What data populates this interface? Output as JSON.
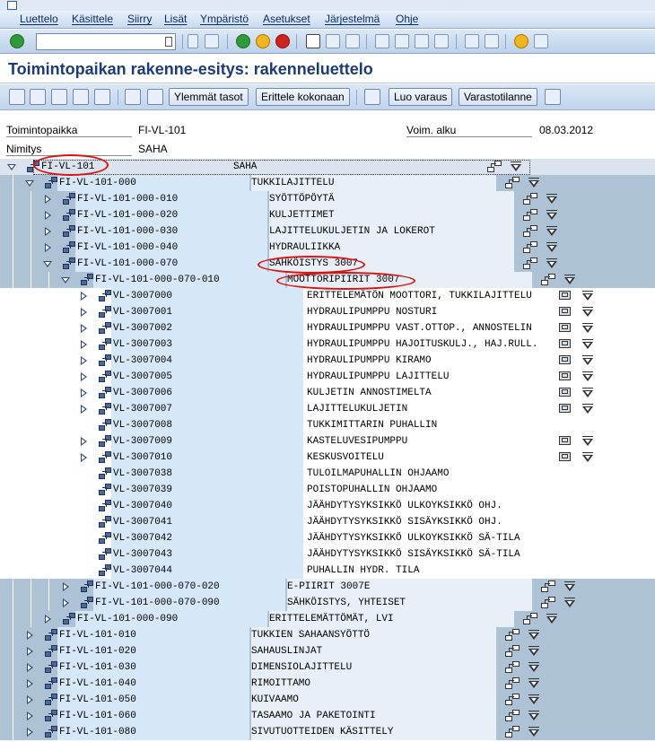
{
  "menu": [
    "Luettelo",
    "Käsittele",
    "Siirry",
    "Lisät",
    "Ympäristö",
    "Asetukset",
    "Järjestelmä",
    "Ohje"
  ],
  "command_field": {
    "value": ""
  },
  "title": "Toimintopaikan rakenne-esitys: rakenneluettelo",
  "app_buttons": [
    "Ylemmät tasot",
    "Erittele kokonaan",
    "Luo varaus",
    "Varastotilanne"
  ],
  "header": {
    "func_loc_label": "Toimintopaikka",
    "func_loc_value": "FI-VL-101",
    "valid_from_label": "Voim. alku",
    "valid_from_value": "08.03.2012",
    "desc_label": "Nimitys",
    "desc_value": "SAHA"
  },
  "rows": [
    {
      "level": 0,
      "state": "open",
      "id": "FI-VL-101",
      "desc": "SAHA",
      "icon": "funcloc",
      "act": true
    },
    {
      "level": 1,
      "state": "open",
      "id": "FI-VL-101-000",
      "desc": "TUKKILAJITTELU",
      "icon": "funcloc",
      "act": true
    },
    {
      "level": 2,
      "state": "closed",
      "id": "FI-VL-101-000-010",
      "desc": "SYÖTTÖPÖYTÄ",
      "icon": "funcloc",
      "act": true
    },
    {
      "level": 2,
      "state": "closed",
      "id": "FI-VL-101-000-020",
      "desc": "KULJETTIMET",
      "icon": "funcloc",
      "act": true
    },
    {
      "level": 2,
      "state": "closed",
      "id": "FI-VL-101-000-030",
      "desc": "LAJITTELUKULJETIN JA LOKEROT",
      "icon": "funcloc",
      "act": true
    },
    {
      "level": 2,
      "state": "closed",
      "id": "FI-VL-101-000-040",
      "desc": "HYDRAULIIKKA",
      "icon": "funcloc",
      "act": true
    },
    {
      "level": 2,
      "state": "open",
      "id": "FI-VL-101-000-070",
      "desc": "SÄHKÖISTYS 3007",
      "icon": "funcloc",
      "act": true
    },
    {
      "level": 3,
      "state": "open",
      "id": "FI-VL-101-000-070-010",
      "desc": "MOOTTORIPIIRIT 3007",
      "icon": "funcloc",
      "act": true
    },
    {
      "level": 4,
      "state": "closed",
      "id": "VL-3007000",
      "desc": "ERITTELEMÄTÖN MOOTTORI, TUKKILAJITTELU",
      "icon": "equip",
      "act": true
    },
    {
      "level": 4,
      "state": "closed",
      "id": "VL-3007001",
      "desc": "HYDRAULIPUMPPU NOSTURI",
      "icon": "equip",
      "act": true
    },
    {
      "level": 4,
      "state": "closed",
      "id": "VL-3007002",
      "desc": "HYDRAULIPUMPPU VAST.OTTOP., ANNOSTELIN",
      "icon": "equip",
      "act": true
    },
    {
      "level": 4,
      "state": "closed",
      "id": "VL-3007003",
      "desc": "HYDRAULIPUMPPU HAJOITUSKULJ., HAJ.RULL.",
      "icon": "equip",
      "act": true
    },
    {
      "level": 4,
      "state": "closed",
      "id": "VL-3007004",
      "desc": "HYDRAULIPUMPPU KIRAMO",
      "icon": "equip",
      "act": true
    },
    {
      "level": 4,
      "state": "closed",
      "id": "VL-3007005",
      "desc": "HYDRAULIPUMPPU LAJITTELU",
      "icon": "equip",
      "act": true
    },
    {
      "level": 4,
      "state": "closed",
      "id": "VL-3007006",
      "desc": "KULJETIN ANNOSTIMELTA",
      "icon": "equip",
      "act": true
    },
    {
      "level": 4,
      "state": "closed",
      "id": "VL-3007007",
      "desc": "LAJITTELUKULJETIN",
      "icon": "equip",
      "act": true
    },
    {
      "level": 4,
      "state": "none",
      "id": "VL-3007008",
      "desc": "TUKKIMITTARIN PUHALLIN",
      "icon": "equip",
      "act": false
    },
    {
      "level": 4,
      "state": "closed",
      "id": "VL-3007009",
      "desc": "KASTELUVESIPUMPPU",
      "icon": "equip",
      "act": true
    },
    {
      "level": 4,
      "state": "closed",
      "id": "VL-3007010",
      "desc": "KESKUSVOITELU",
      "icon": "equip",
      "act": true
    },
    {
      "level": 4,
      "state": "none",
      "id": "VL-3007038",
      "desc": "TULOILMAPUHALLIN OHJAAMO",
      "icon": "equip",
      "act": false
    },
    {
      "level": 4,
      "state": "none",
      "id": "VL-3007039",
      "desc": "POISTOPUHALLIN OHJAAMO",
      "icon": "equip",
      "act": false
    },
    {
      "level": 4,
      "state": "none",
      "id": "VL-3007040",
      "desc": "JÄÄHDYTYSYKSIKKÖ ULKOYKSIKKÖ OHJ.",
      "icon": "equip",
      "act": false
    },
    {
      "level": 4,
      "state": "none",
      "id": "VL-3007041",
      "desc": "JÄÄHDYTYSYKSIKKÖ SISÄYKSIKKÖ OHJ.",
      "icon": "equip",
      "act": false
    },
    {
      "level": 4,
      "state": "none",
      "id": "VL-3007042",
      "desc": "JÄÄHDYTYSYKSIKKÖ ULKOYKSIKKÖ SÄ-TILA",
      "icon": "equip",
      "act": false
    },
    {
      "level": 4,
      "state": "none",
      "id": "VL-3007043",
      "desc": "JÄÄHDYTYSYKSIKKÖ SISÄYKSIKKÖ SÄ-TILA",
      "icon": "equip",
      "act": false
    },
    {
      "level": 4,
      "state": "none",
      "id": "VL-3007044",
      "desc": "PUHALLIN HYDR. TILA",
      "icon": "equip",
      "act": false
    },
    {
      "level": 3,
      "state": "closed",
      "id": "FI-VL-101-000-070-020",
      "desc": "E-PIIRIT 3007E",
      "icon": "funcloc",
      "act": true
    },
    {
      "level": 3,
      "state": "closed",
      "id": "FI-VL-101-000-070-090",
      "desc": "SÄHKÖISTYS, YHTEISET",
      "icon": "funcloc",
      "act": true
    },
    {
      "level": 2,
      "state": "closed",
      "id": "FI-VL-101-000-090",
      "desc": "ERITTELEMÄTTÖMÄT, LVI",
      "icon": "funcloc",
      "act": true
    },
    {
      "level": 1,
      "state": "closed",
      "id": "FI-VL-101-010",
      "desc": "TUKKIEN SAHAANSYÖTTÖ",
      "icon": "funcloc",
      "act": true
    },
    {
      "level": 1,
      "state": "closed",
      "id": "FI-VL-101-020",
      "desc": "SAHAUSLINJAT",
      "icon": "funcloc",
      "act": true
    },
    {
      "level": 1,
      "state": "closed",
      "id": "FI-VL-101-030",
      "desc": "DIMENSIOLAJITTELU",
      "icon": "funcloc",
      "act": true
    },
    {
      "level": 1,
      "state": "closed",
      "id": "FI-VL-101-040",
      "desc": "RIMOITTAMO",
      "icon": "funcloc",
      "act": true
    },
    {
      "level": 1,
      "state": "closed",
      "id": "FI-VL-101-050",
      "desc": "KUIVAAMO",
      "icon": "funcloc",
      "act": true
    },
    {
      "level": 1,
      "state": "closed",
      "id": "FI-VL-101-060",
      "desc": "TASAAMO JA PAKETOINTI",
      "icon": "funcloc",
      "act": true
    },
    {
      "level": 1,
      "state": "closed",
      "id": "FI-VL-101-080",
      "desc": "SIVUTUOTTEIDEN KÄSITTELY",
      "icon": "funcloc",
      "act": true
    }
  ],
  "colors": {
    "menu_text": "#0b2a6a",
    "title_text": "#1b3b7c",
    "row_dark": "#aec2d6",
    "row_light": "#e9eff6",
    "id_col_bg": "#d6e8f8",
    "annotation": "#dd1111"
  }
}
